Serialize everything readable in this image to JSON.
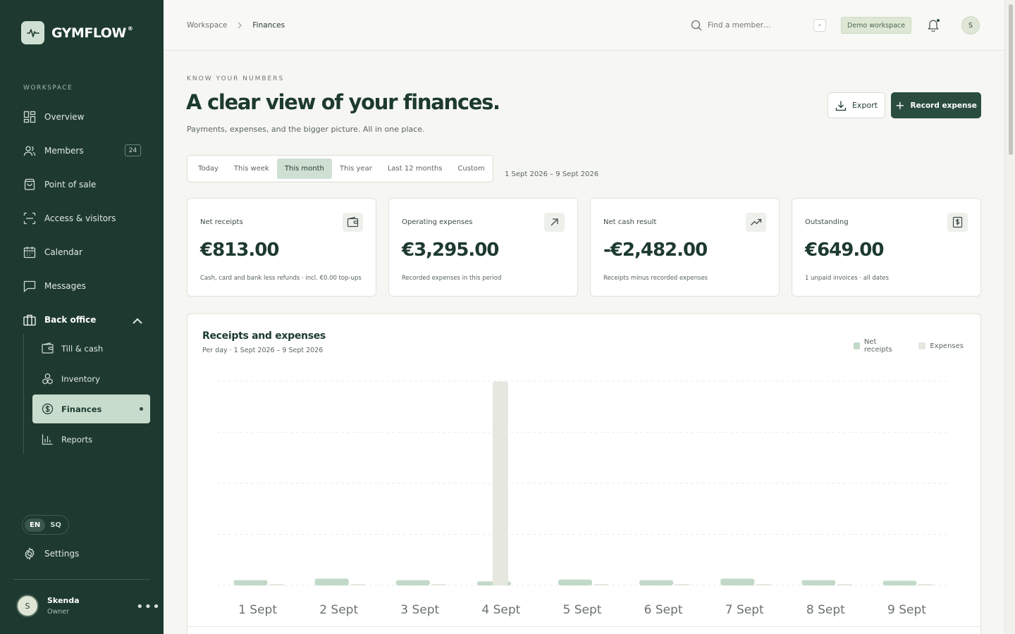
{
  "brand": {
    "name": "GYMFLOW",
    "mark": "®"
  },
  "sidebar": {
    "section_label": "WORKSPACE",
    "items": [
      {
        "label": "Overview",
        "icon": "grid-icon"
      },
      {
        "label": "Members",
        "icon": "users-icon",
        "badge": "24"
      },
      {
        "label": "Point of sale",
        "icon": "shopping-bag-icon"
      },
      {
        "label": "Access & visitors",
        "icon": "scan-icon"
      },
      {
        "label": "Calendar",
        "icon": "calendar-icon"
      },
      {
        "label": "Messages",
        "icon": "message-icon"
      }
    ],
    "group": {
      "label": "Back office",
      "icon": "briefcase-icon",
      "expanded": true
    },
    "sub_items": [
      {
        "label": "Till & cash",
        "icon": "wallet-icon"
      },
      {
        "label": "Inventory",
        "icon": "boxes-icon"
      },
      {
        "label": "Finances",
        "icon": "dollar-circle-icon",
        "active": true
      },
      {
        "label": "Reports",
        "icon": "bar-chart-icon"
      }
    ],
    "languages": [
      "EN",
      "SQ"
    ],
    "active_language": "EN",
    "settings_label": "Settings",
    "user": {
      "initial": "S",
      "name": "Skenda",
      "role": "Owner"
    }
  },
  "header": {
    "breadcrumb": [
      "Workspace",
      "Finances"
    ],
    "search_placeholder": "Find a member…",
    "search_shortcut": "⌕",
    "workspace_badge": "Demo workspace",
    "avatar_initial": "S"
  },
  "page": {
    "eyebrow": "KNOW YOUR NUMBERS",
    "title": "A clear view of your finances.",
    "subtitle": "Payments, expenses, and the bigger picture. All in one place.",
    "export_label": "Export",
    "record_label": "Record expense",
    "periods": [
      "Today",
      "This week",
      "This month",
      "This year",
      "Last 12 months",
      "Custom"
    ],
    "active_period": "This month",
    "range": "1 Sept 2026 – 9 Sept 2026"
  },
  "kpis": [
    {
      "label": "Net receipts",
      "value": "€813.00",
      "note": "Cash, card and bank less refunds · incl. €0.00 top-ups",
      "icon": "wallet-icon"
    },
    {
      "label": "Operating expenses",
      "value": "€3,295.00",
      "note": "Recorded expenses in this period",
      "icon": "arrow-up-right-icon"
    },
    {
      "label": "Net cash result",
      "value": "-€2,482.00",
      "note": "Receipts minus recorded expenses",
      "icon": "trending-up-icon"
    },
    {
      "label": "Outstanding",
      "value": "€649.00",
      "note": "1 unpaid invoices · all dates",
      "icon": "invoice-dollar-icon"
    }
  ],
  "colors": {
    "sidebar": "#1e3a30",
    "accent": "#2b4d40",
    "receipts": "#c2d9c8",
    "expenses": "#e6e8e0"
  },
  "chart_data": {
    "type": "bar",
    "title": "Receipts and expenses",
    "subtitle": "Per day · 1 Sept 2026 – 9 Sept 2026",
    "categories": [
      "1 Sept",
      "2 Sept",
      "3 Sept",
      "4 Sept",
      "5 Sept",
      "6 Sept",
      "7 Sept",
      "8 Sept",
      "9 Sept"
    ],
    "series": [
      {
        "name": "Net receipts",
        "values": [
          85,
          110,
          85,
          65,
          95,
          85,
          110,
          85,
          75
        ]
      },
      {
        "name": "Expenses",
        "values": [
          15,
          15,
          15,
          3295,
          15,
          15,
          15,
          15,
          15
        ]
      }
    ],
    "ylim": [
      0,
      3300
    ],
    "grid": true,
    "legend": "top-right"
  }
}
